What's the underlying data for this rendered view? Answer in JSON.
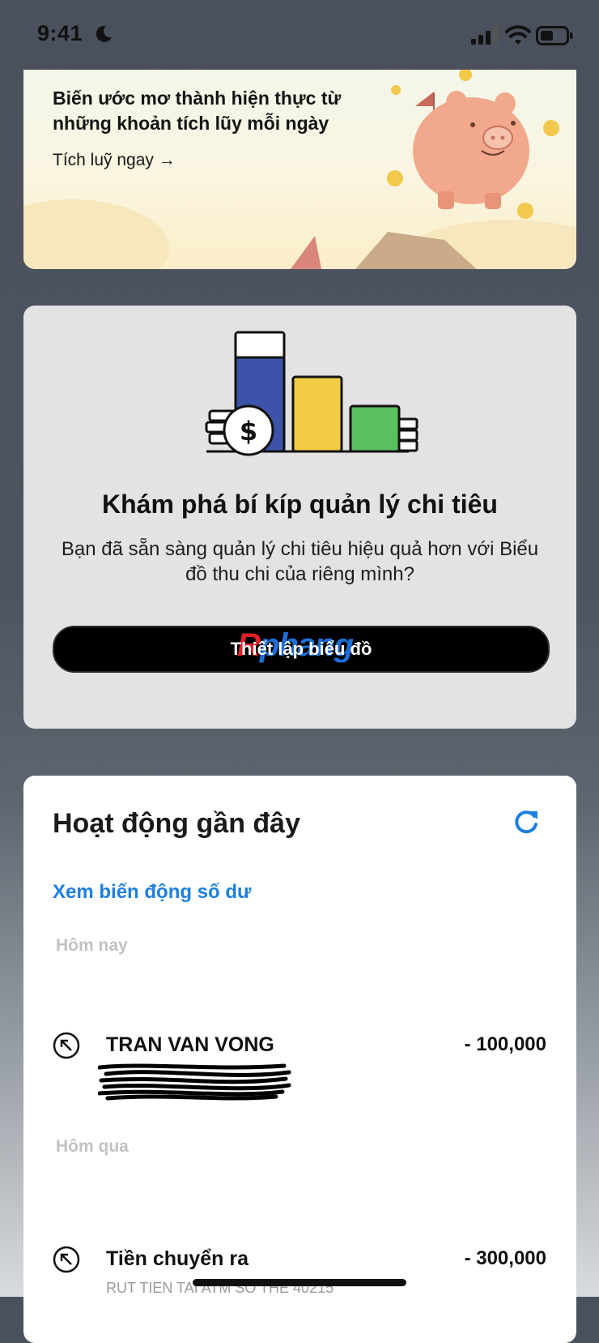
{
  "status_bar": {
    "time": "9:41",
    "icons": [
      "moon-icon",
      "signal-icon",
      "wifi-icon",
      "battery-icon"
    ]
  },
  "savings_banner": {
    "title": "Biến ước mơ thành hiện thực từ những khoản tích lũy mỗi ngày",
    "link_label": "Tích luỹ ngay →",
    "illustration": "piggy-bank-icon"
  },
  "chart_promo": {
    "illustration": "bar-chart-coins-icon",
    "title": "Khám phá bí kíp quản lý chi tiêu",
    "description": "Bạn đã sẵn sàng quản lý chi tiêu hiệu quả hơn với Biểu đồ thu chi của riêng mình?",
    "button_label": "Thiết lập biểu đồ",
    "watermark_a": "R",
    "watermark_b": "phang"
  },
  "activity": {
    "title": "Hoạt động gần đây",
    "balance_link": "Xem biến động số dư",
    "groups": [
      {
        "label": "Hôm nay",
        "transactions": [
          {
            "name": "TRAN VAN VONG",
            "amount": "- 100,000",
            "direction_icon": "outgoing-arrow-icon"
          }
        ]
      },
      {
        "label": "Hôm qua",
        "transactions": [
          {
            "name": "Tiền chuyển ra",
            "amount": "- 300,000",
            "subtitle": "RUT TIEN TAI ATM SO THE 40215",
            "direction_icon": "outgoing-arrow-icon"
          }
        ]
      }
    ]
  },
  "colors": {
    "accent_blue": "#1d7fe0",
    "button_black": "#000000",
    "chart_blue": "#3d52a8",
    "chart_yellow": "#f2cc45",
    "chart_green": "#5bbf5f"
  }
}
